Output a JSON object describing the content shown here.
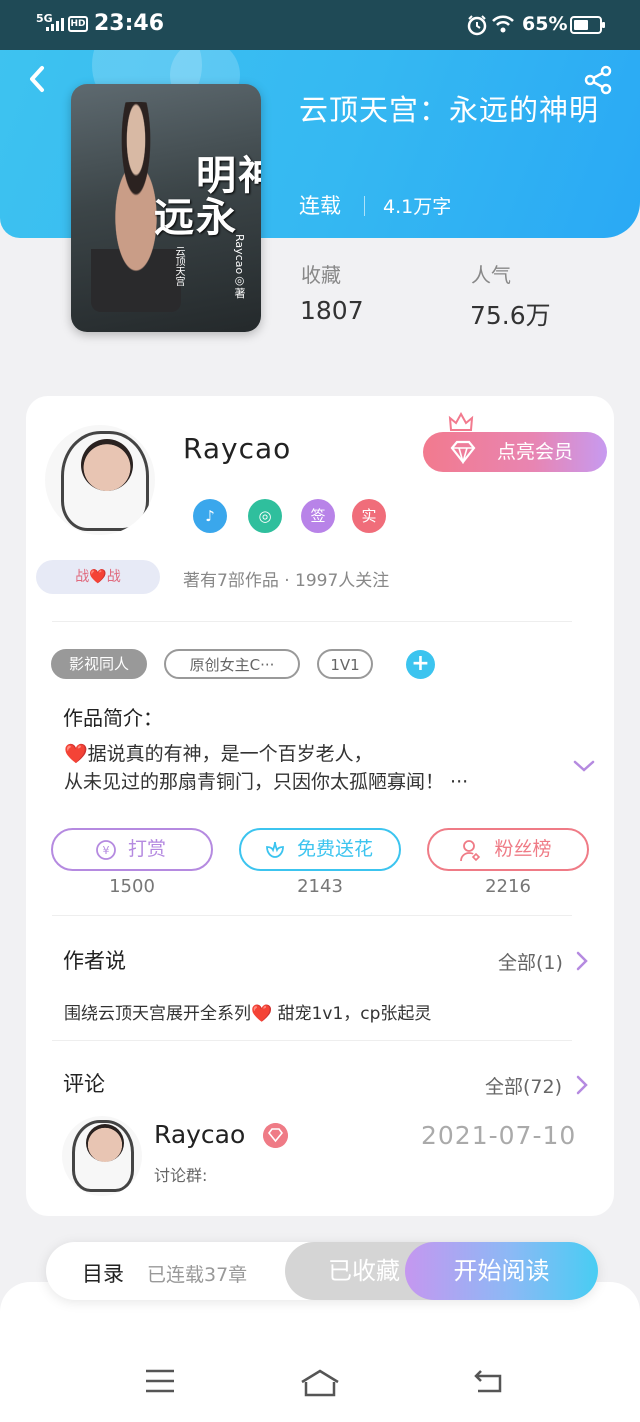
{
  "status_bar": {
    "network": "5G",
    "hd": "HD",
    "time": "23:46",
    "battery": "65%"
  },
  "book": {
    "title": "云顶天宫：永远的神明",
    "status": "连载",
    "word_count": "4.1万字",
    "cover": {
      "title_lines": [
        "永远",
        "的神明"
      ],
      "subtitle": "云顶天宫",
      "author": "Raycao◎著"
    },
    "stats": [
      {
        "label": "收藏",
        "value": "1807"
      },
      {
        "label": "人气",
        "value": "75.6万"
      }
    ]
  },
  "author": {
    "name": "Raycao",
    "vip_button": "点亮会员",
    "badge": "战❤️战",
    "medals": [
      {
        "icon": "music-note-icon",
        "color": "#3aa7ec"
      },
      {
        "icon": "planet-icon",
        "color": "#2fbf9d"
      },
      {
        "text": "签",
        "color": "#b883e8"
      },
      {
        "text": "实",
        "color": "#f06d7a"
      }
    ],
    "meta": "著有7部作品 · 1997人关注"
  },
  "tags": [
    "影视同人",
    "原创女主C···",
    "1V1"
  ],
  "intro": {
    "heading": "作品简介：",
    "lines": [
      "❤️据说真的有神，是一个百岁老人，",
      "从未见过的那扇青铜门，只因你太孤陋寡闻！ ···"
    ]
  },
  "actions": [
    {
      "label": "打赏",
      "count": "1500",
      "color": "#b58ae0"
    },
    {
      "label": "免费送花",
      "count": "2143",
      "color": "#3cc4ef"
    },
    {
      "label": "粉丝榜",
      "count": "2216",
      "color": "#ef7b86"
    }
  ],
  "author_say": {
    "heading": "作者说",
    "more": "全部(1)",
    "text": "围绕云顶天宫展开全系列❤️ 甜宠1v1，cp张起灵"
  },
  "comments": {
    "heading": "评论",
    "more": "全部(72)",
    "items": [
      {
        "name": "Raycao",
        "date": "2021-07-10",
        "text": "讨论群:"
      }
    ]
  },
  "bottom_bar": {
    "toc": "目录",
    "toc_status": "已连载37章",
    "favorite": "已收藏",
    "read": "开始阅读"
  },
  "colors": {
    "header": "#35b8f2",
    "accent_blue": "#3cc4ef",
    "vip_pink": "#f27a8e"
  }
}
